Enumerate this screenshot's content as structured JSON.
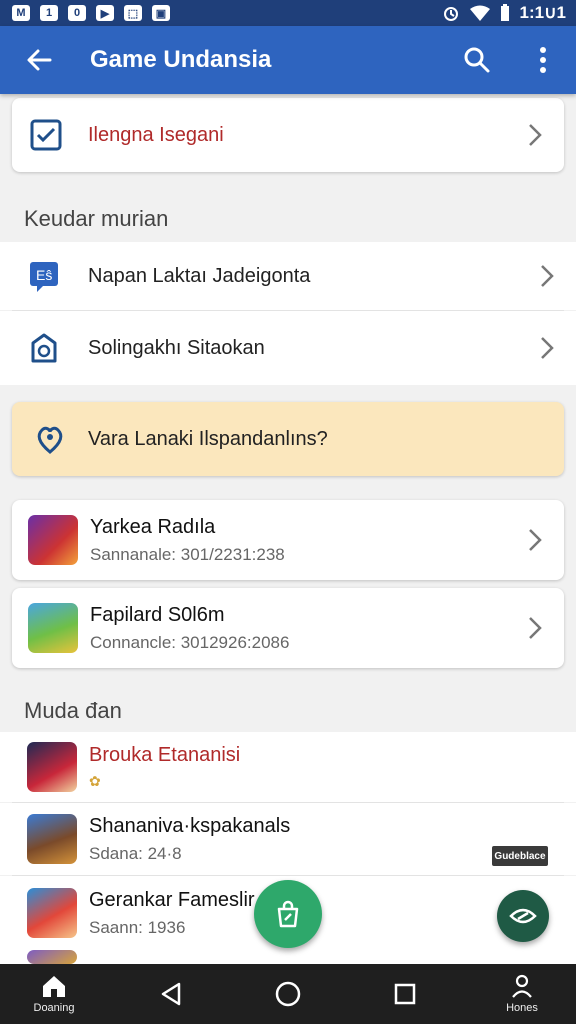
{
  "status_bar": {
    "left_icons": [
      "notification-icon",
      "info-icon",
      "circle-badge-icon",
      "play-icon",
      "gallery-icon",
      "tablet-icon"
    ],
    "left_glyphs": [
      "M",
      "1",
      "0",
      "▶",
      "⬚",
      "▣"
    ],
    "time": "1:1∪1"
  },
  "app_bar": {
    "title": "Game Undansia"
  },
  "top_card": {
    "label": "Ilengna Isegani",
    "label_color": "#b02a2a"
  },
  "section1": {
    "title": "Keudar murian",
    "items": [
      {
        "label": "Napan Laktaı Jadeigonta",
        "icon": "chat-settings-icon"
      },
      {
        "label": "Solingakhı Sitaokan",
        "icon": "refresh-box-icon"
      }
    ]
  },
  "banner": {
    "text": "Vara Lanaki Ilspandanlıns?",
    "bg": "#fbe7bd"
  },
  "game_cards": [
    {
      "title": "Yarkea Radıla",
      "subtitle": "Sannanale: 301/2231:238"
    },
    {
      "title": "Fapilard S0l6m",
      "subtitle": "Connancle: 3012926:2086"
    }
  ],
  "section2": {
    "title": "Muda đan",
    "items": [
      {
        "title": "Brouka Etananisi",
        "subtitle": "✿",
        "title_color": "#b02a2a"
      },
      {
        "title": "Shananiva·kspakanals",
        "subtitle": "Sdana: 24·8"
      },
      {
        "title": "Gerankar Fameslir",
        "subtitle": "Saann: 1936"
      }
    ]
  },
  "floating_tag": "Gudeblace",
  "nav": {
    "home_label": "Doaning",
    "profile_label": "Hones"
  },
  "colors": {
    "app_bar": "#2e64bf",
    "status_bar": "#1f3f7a",
    "fab": "#2ea86b",
    "fab_side": "#1f5a45"
  }
}
